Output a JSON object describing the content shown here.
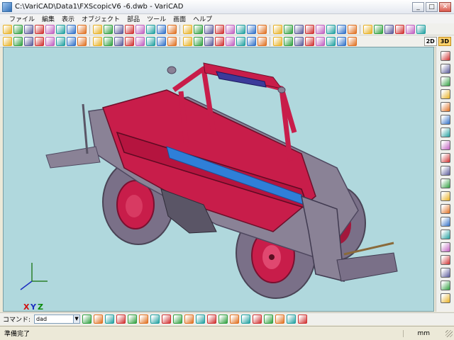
{
  "window": {
    "title": "C:\\VariCAD\\Data1\\FXScopicV6 -6.dwb - VariCAD",
    "minimize": "_",
    "maximize": "□",
    "close": "✕"
  },
  "menu": [
    "ファイル",
    "編集",
    "表示",
    "オブジェクト",
    "部品",
    "ツール",
    "画面",
    "ヘルプ"
  ],
  "toolbar1": {
    "icons": [
      "new-icon",
      "open-icon",
      "save-icon",
      "save-as-icon",
      "print-icon",
      "copy-icon",
      "undo-icon",
      "redo-icon",
      "box-icon",
      "cylinder-icon",
      "cone-icon",
      "sphere-icon",
      "torus-icon",
      "revolve-icon",
      "extrude-icon",
      "loft-icon",
      "sweep-icon",
      "move-icon",
      "rotate-icon",
      "mirror-icon",
      "array-icon",
      "scale-icon",
      "boolean-icon",
      "hole-icon",
      "fillet-icon",
      "chamfer-icon",
      "shell-icon",
      "cut-icon",
      "view-icon",
      "zoom-icon",
      "zoom-in-icon",
      "zoom-out-icon",
      "pan-icon",
      "fit-icon",
      "shade-icon",
      "wire-icon",
      "layer-icon",
      "color-icon"
    ]
  },
  "toolbar2": {
    "icons": [
      "delete-icon",
      "trim-icon",
      "split-icon",
      "join-icon",
      "attach-icon",
      "tools-icon",
      "blank-icon",
      "blank-icon",
      "dimension-icon",
      "measure-icon",
      "section-icon",
      "group-icon",
      "ungroup-icon",
      "part-icon",
      "assembly-icon",
      "bom-icon",
      "pipe-icon",
      "spring-icon",
      "bolt-icon",
      "nut-icon",
      "washer-icon",
      "pin-icon",
      "bearing-icon",
      "gear-icon",
      "shaft-icon",
      "sheet-icon",
      "weld-icon",
      "label-icon",
      "note-icon",
      "check-icon",
      "settings-icon",
      "info-icon"
    ],
    "mode_2d": "2D",
    "mode_3d": "3D"
  },
  "right_toolbar": {
    "icons": [
      "view-front-icon",
      "view-back-icon",
      "view-left-icon",
      "view-right-icon",
      "view-top-icon",
      "view-bottom-icon",
      "view-iso1-icon",
      "view-iso2-icon",
      "view-iso3-icon",
      "view-iso4-icon",
      "rotate-view-icon",
      "orbit-icon",
      "perspective-icon",
      "section-view-icon",
      "clip-icon",
      "explode-icon",
      "hide-icon",
      "show-icon",
      "light-icon",
      "material-icon"
    ]
  },
  "axes": {
    "x": "X",
    "y": "Y",
    "z": "Z"
  },
  "command": {
    "label": "コマンド:",
    "value": "dad"
  },
  "cmd_icons": [
    "calc-icon",
    "snap-icon",
    "angle-icon",
    "line-icon",
    "grid-icon",
    "ortho-icon",
    "pointer-icon",
    "select-icon",
    "window-icon",
    "cross-icon",
    "filter-icon",
    "layer-icon",
    "block-icon",
    "copy-icon",
    "paste-icon",
    "delete-icon",
    "props-icon",
    "sheet-icon",
    "table-icon",
    "text-icon"
  ],
  "status": {
    "text": "準備完了",
    "units": "mm"
  },
  "colors": {
    "viewport_bg": "#b0d8dd",
    "body_red": "#c81d4a",
    "body_gray": "#8a8296",
    "accent_blue": "#2f7fd8"
  }
}
